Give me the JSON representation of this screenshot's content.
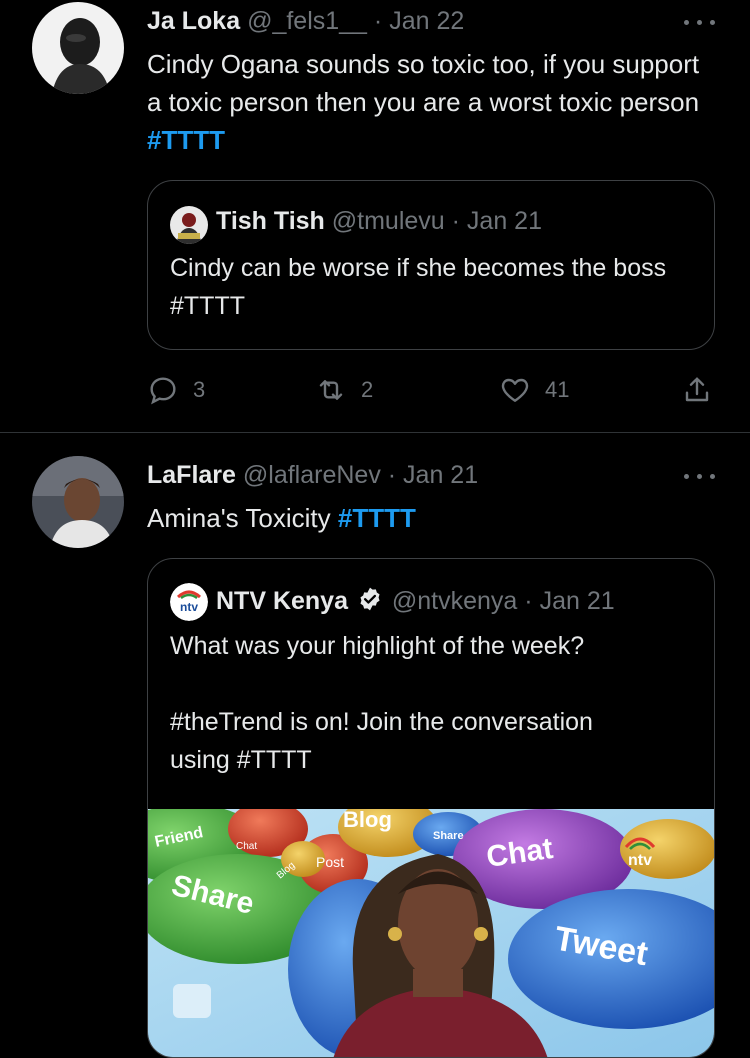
{
  "tweets": [
    {
      "name": "Ja Loka",
      "handle": "@_fels1__",
      "date": "· Jan 22",
      "text": "Cindy Ogana sounds so toxic too, if you support a toxic person then you are a worst toxic person ",
      "hashtag": "#TTTT",
      "quote": {
        "name": "Tish Tish",
        "handle": "@tmulevu",
        "date": "· Jan 21",
        "text": "Cindy can be worse if she becomes the boss #TTTT"
      },
      "actions": {
        "replies": "3",
        "retweets": "2",
        "likes": "41"
      }
    },
    {
      "name": "LaFlare",
      "handle": "@laflareNev",
      "date": "· Jan 21",
      "text": "Amina's Toxicity ",
      "hashtag": "#TTTT",
      "quote": {
        "name": "NTV Kenya",
        "handle": "@ntvkenya",
        "date": "· Jan 21",
        "text_line1": "What was your highlight of the week?",
        "text_line2": "#theTrend is on! Join the conversation",
        "text_line3": "using #TTTT",
        "avatar_label": "ntv",
        "media": {
          "words": [
            "Friend",
            "Share",
            "Blog",
            "Share",
            "Chat",
            "Post",
            "Blog",
            "Chat",
            "Tweet"
          ],
          "logo": "ntv"
        }
      }
    }
  ],
  "colors": {
    "link": "#1d9bf0",
    "muted": "#71767b",
    "border": "#3e4144"
  }
}
